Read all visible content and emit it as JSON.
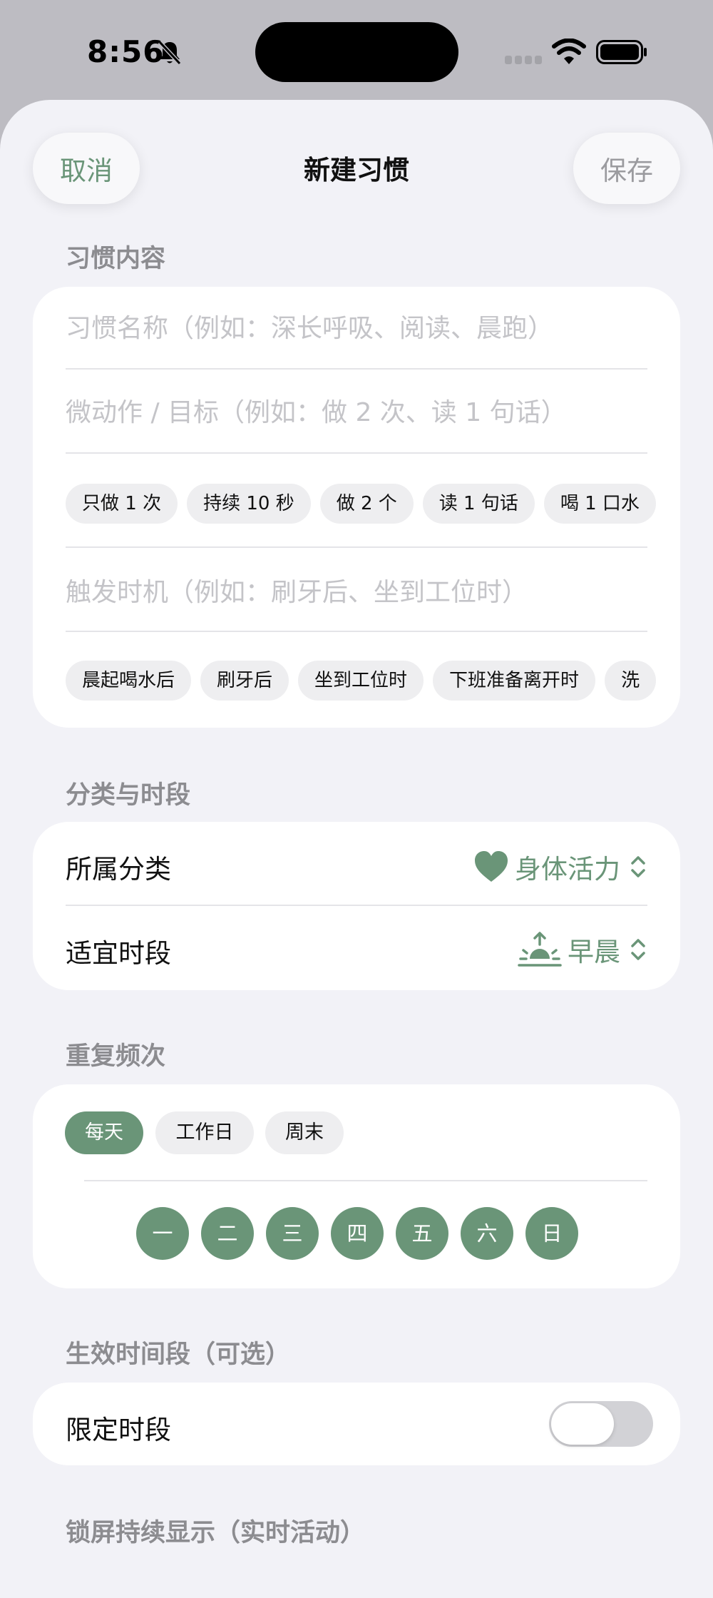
{
  "status_bar": {
    "time": "8:56"
  },
  "nav": {
    "cancel_label": "取消",
    "title": "新建习惯",
    "save_label": "保存"
  },
  "content_section": {
    "header": "习惯内容",
    "name_placeholder": "习惯名称（例如：深长呼吸、阅读、晨跑）",
    "name_value": "",
    "action_placeholder": "微动作 / 目标（例如：做 2 次、读 1 句话）",
    "action_value": "",
    "action_chips": [
      "只做 1 次",
      "持续 10 秒",
      "做 2 个",
      "读 1 句话",
      "喝 1 口水"
    ],
    "trigger_placeholder": "触发时机（例如：刷牙后、坐到工位时）",
    "trigger_value": "",
    "trigger_chips": [
      "晨起喝水后",
      "刷牙后",
      "坐到工位时",
      "下班准备离开时",
      "洗"
    ]
  },
  "category_section": {
    "header": "分类与时段",
    "category_label": "所属分类",
    "category_value": "身体活力",
    "category_icon": "heart-icon",
    "period_label": "适宜时段",
    "period_value": "早晨",
    "period_icon": "sunrise-icon"
  },
  "frequency_section": {
    "header": "重复频次",
    "options": [
      "每天",
      "工作日",
      "周末"
    ],
    "selected": "每天",
    "weekdays": [
      "一",
      "二",
      "三",
      "四",
      "五",
      "六",
      "日"
    ]
  },
  "active_period_section": {
    "header": "生效时间段（可选）",
    "limit_label": "限定时段",
    "limit_enabled": false
  },
  "lockscreen_section": {
    "header": "锁屏持续显示（实时活动）"
  },
  "colors": {
    "accent": "#6a9578",
    "background": "#f2f2f7",
    "card": "#ffffff",
    "chip": "#eeeef0",
    "placeholder": "#c4c4c8"
  }
}
